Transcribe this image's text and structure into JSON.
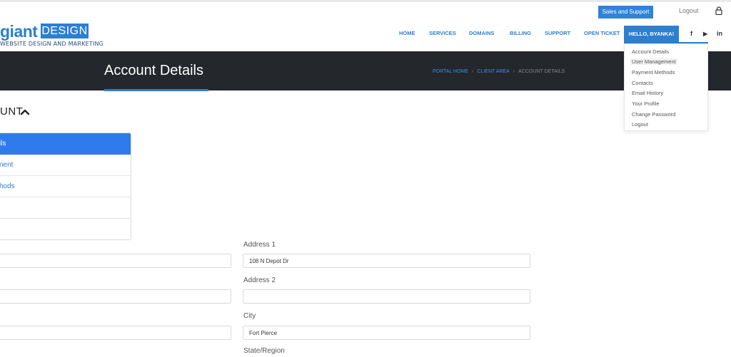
{
  "header": {
    "sales_support": "Sales and Support",
    "logout": "Logout"
  },
  "logo": {
    "word1": "giant",
    "word2": "DESIGN",
    "tagline": "WEBSITE DESIGN AND MARKETING"
  },
  "nav": {
    "items": [
      "HOME",
      "SERVICES",
      "DOMAINS",
      "BILLING",
      "SUPPORT",
      "OPEN TICKET"
    ],
    "user_greeting": "HELLO, BYANKA!",
    "social": [
      "f",
      "▶",
      "in"
    ]
  },
  "banner": {
    "title": "Account Details",
    "breadcrumb": [
      "PORTAL HOME",
      "CLIENT AREA",
      "ACCOUNT DETAILS"
    ]
  },
  "account_menu": {
    "items": [
      "Account Details",
      "User Management",
      "Payment Methods",
      "Contacts",
      "Email History",
      "Your Profile",
      "Change Password",
      "Logout"
    ],
    "hovered_index": 1
  },
  "section": {
    "heading": "UNT"
  },
  "sidebar": {
    "items": [
      "ils",
      "nent",
      "hods",
      "",
      ""
    ]
  },
  "form": {
    "address1_label": "Address 1",
    "address1_value": "108 N Depot Dr",
    "address2_label": "Address 2",
    "address2_value": "",
    "city_label": "City",
    "city_value": "Fort Pierce",
    "state_label": "State/Region",
    "left_values": [
      "",
      "",
      ""
    ]
  },
  "colors": {
    "accent": "#2d7fd0",
    "banner": "#24272c",
    "active_item": "#2f7bec"
  }
}
